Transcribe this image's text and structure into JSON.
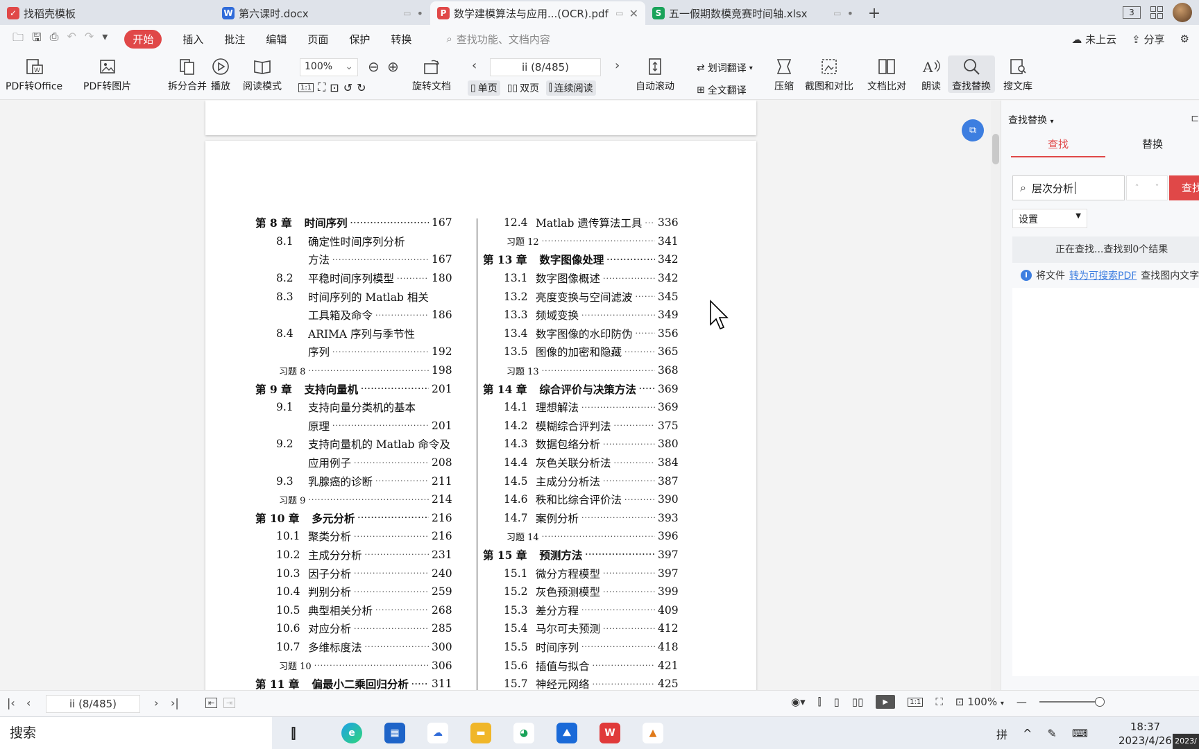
{
  "tabs": [
    {
      "label": "找稻壳模板",
      "color": "#e04848",
      "glyph": "✓"
    },
    {
      "label": "第六课时.docx",
      "color": "#2f6bd9",
      "glyph": "W"
    },
    {
      "label": "数学建模算法与应用...(OCR).pdf",
      "color": "#e04848",
      "glyph": "P",
      "active": true
    },
    {
      "label": "五一假期数模竞赛时间轴.xlsx",
      "color": "#1aa35a",
      "glyph": "S"
    }
  ],
  "tabbar_right": {
    "badge": "3"
  },
  "menu": {
    "items": [
      "开始",
      "插入",
      "批注",
      "编辑",
      "页面",
      "保护",
      "转换"
    ],
    "active_index": 0,
    "search_placeholder": "查找功能、文档内容",
    "cloud": "未上云",
    "share": "分享"
  },
  "toolbar": {
    "pdf_to_office": "PDF转Office",
    "pdf_to_image": "PDF转图片",
    "split_merge": "拆分合并",
    "play": "播放",
    "read_mode": "阅读模式",
    "zoom": "100%",
    "rotate": "旋转文档",
    "page_indicator": "ii (8/485)",
    "single": "单页",
    "double": "双页",
    "continuous": "连续阅读",
    "auto_scroll": "自动滚动",
    "word_translate": "划词翻译",
    "full_translate": "全文翻译",
    "compress": "压缩",
    "screenshot_compare": "截图和对比",
    "doc_compare": "文档比对",
    "read_aloud": "朗读",
    "find_replace": "查找替换",
    "search_lib": "搜文库"
  },
  "toc_left": [
    {
      "type": "chapter",
      "num": "第 8 章",
      "title": "时间序列",
      "page": "167"
    },
    {
      "type": "sec",
      "num": "8.1",
      "title": "确定性时间序列分析",
      "page": ""
    },
    {
      "type": "cont",
      "title": "方法",
      "page": "167"
    },
    {
      "type": "sec",
      "num": "8.2",
      "title": "平稳时间序列模型",
      "page": "180"
    },
    {
      "type": "sec",
      "num": "8.3",
      "title": "时间序列的 Matlab 相关",
      "page": ""
    },
    {
      "type": "cont",
      "title": "工具箱及命令",
      "page": "186"
    },
    {
      "type": "sec",
      "num": "8.4",
      "title": "ARIMA 序列与季节性",
      "page": ""
    },
    {
      "type": "cont",
      "title": "序列",
      "page": "192"
    },
    {
      "type": "ex",
      "title": "习题 8",
      "page": "198"
    },
    {
      "type": "chapter",
      "num": "第 9 章",
      "title": "支持向量机",
      "page": "201"
    },
    {
      "type": "sec",
      "num": "9.1",
      "title": "支持向量分类机的基本",
      "page": ""
    },
    {
      "type": "cont",
      "title": "原理",
      "page": "201"
    },
    {
      "type": "sec",
      "num": "9.2",
      "title": "支持向量机的 Matlab 命令及",
      "page": ""
    },
    {
      "type": "cont",
      "title": "应用例子",
      "page": "208"
    },
    {
      "type": "sec",
      "num": "9.3",
      "title": "乳腺癌的诊断",
      "page": "211"
    },
    {
      "type": "ex",
      "title": "习题 9",
      "page": "214"
    },
    {
      "type": "chapter",
      "num": "第 10 章",
      "title": "多元分析",
      "page": "216"
    },
    {
      "type": "sec",
      "num": "10.1",
      "title": "聚类分析",
      "page": "216"
    },
    {
      "type": "sec",
      "num": "10.2",
      "title": "主成分分析",
      "page": "231"
    },
    {
      "type": "sec",
      "num": "10.3",
      "title": "因子分析",
      "page": "240"
    },
    {
      "type": "sec",
      "num": "10.4",
      "title": "判别分析",
      "page": "259"
    },
    {
      "type": "sec",
      "num": "10.5",
      "title": "典型相关分析",
      "page": "268"
    },
    {
      "type": "sec",
      "num": "10.6",
      "title": "对应分析",
      "page": "285"
    },
    {
      "type": "sec",
      "num": "10.7",
      "title": "多维标度法",
      "page": "300"
    },
    {
      "type": "ex",
      "title": "习题 10",
      "page": "306"
    },
    {
      "type": "chapter",
      "num": "第 11 章",
      "title": "偏最小二乘回归分析",
      "page": "311"
    }
  ],
  "toc_right": [
    {
      "type": "sec",
      "num": "12.4",
      "title": "Matlab 遗传算法工具",
      "page": "336"
    },
    {
      "type": "ex",
      "title": "习题 12",
      "page": "341"
    },
    {
      "type": "chapter",
      "num": "第 13 章",
      "title": "数字图像处理",
      "page": "342"
    },
    {
      "type": "sec",
      "num": "13.1",
      "title": "数字图像概述",
      "page": "342"
    },
    {
      "type": "sec",
      "num": "13.2",
      "title": "亮度变换与空间滤波",
      "page": "345"
    },
    {
      "type": "sec",
      "num": "13.3",
      "title": "频域变换",
      "page": "349"
    },
    {
      "type": "sec",
      "num": "13.4",
      "title": "数字图像的水印防伪",
      "page": "356"
    },
    {
      "type": "sec",
      "num": "13.5",
      "title": "图像的加密和隐藏",
      "page": "365"
    },
    {
      "type": "ex",
      "title": "习题 13",
      "page": "368"
    },
    {
      "type": "chapter",
      "num": "第 14 章",
      "title": "综合评价与决策方法",
      "page": "369"
    },
    {
      "type": "sec",
      "num": "14.1",
      "title": "理想解法",
      "page": "369"
    },
    {
      "type": "sec",
      "num": "14.2",
      "title": "模糊综合评判法",
      "page": "375"
    },
    {
      "type": "sec",
      "num": "14.3",
      "title": "数据包络分析",
      "page": "380"
    },
    {
      "type": "sec",
      "num": "14.4",
      "title": "灰色关联分析法",
      "page": "384"
    },
    {
      "type": "sec",
      "num": "14.5",
      "title": "主成分分析法",
      "page": "387"
    },
    {
      "type": "sec",
      "num": "14.6",
      "title": "秩和比综合评价法",
      "page": "390"
    },
    {
      "type": "sec",
      "num": "14.7",
      "title": "案例分析",
      "page": "393"
    },
    {
      "type": "ex",
      "title": "习题 14",
      "page": "396"
    },
    {
      "type": "chapter",
      "num": "第 15 章",
      "title": "预测方法",
      "page": "397"
    },
    {
      "type": "sec",
      "num": "15.1",
      "title": "微分方程模型",
      "page": "397"
    },
    {
      "type": "sec",
      "num": "15.2",
      "title": "灰色预测模型",
      "page": "399"
    },
    {
      "type": "sec",
      "num": "15.3",
      "title": "差分方程",
      "page": "409"
    },
    {
      "type": "sec",
      "num": "15.4",
      "title": "马尔可夫预测",
      "page": "412"
    },
    {
      "type": "sec",
      "num": "15.5",
      "title": "时间序列",
      "page": "418"
    },
    {
      "type": "sec",
      "num": "15.6",
      "title": "插值与拟合",
      "page": "421"
    },
    {
      "type": "sec",
      "num": "15.7",
      "title": "神经元网络",
      "page": "425"
    }
  ],
  "find_panel": {
    "header": "查找替换",
    "tab_find": "查找",
    "tab_replace": "替换",
    "query": "层次分析",
    "find_button": "查找",
    "settings": "设置",
    "status": "正在查找...查找到0个结果",
    "info_prefix": "将文件",
    "info_link": "转为可搜索PDF",
    "info_suffix": "查找图内文字"
  },
  "statusbar": {
    "page": "ii (8/485)",
    "zoom": "100%"
  },
  "taskbar": {
    "search": "搜索",
    "ime": "拼",
    "time": "18:37",
    "date": "2023/4/26",
    "badge": "2023/"
  }
}
